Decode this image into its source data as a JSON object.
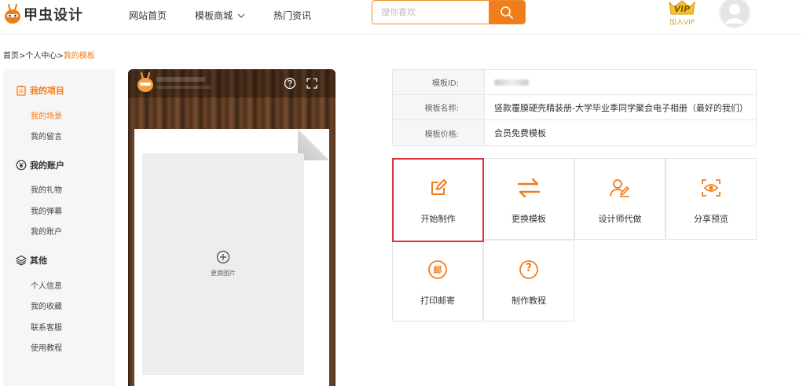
{
  "header": {
    "logo_text": "甲虫设计",
    "nav": [
      "网站首页",
      "模板商城",
      "热门资讯"
    ],
    "search_placeholder": "搜你喜欢",
    "vip_label": "加入VIP",
    "vip_badge": "VIP"
  },
  "breadcrumb": {
    "home": "首页",
    "sep1": ">",
    "center": "个人中心",
    "sep2": ">",
    "current": "我的模板"
  },
  "sidebar": {
    "sections": [
      {
        "title": "我的项目",
        "items": [
          "我的场景",
          "我的留言"
        ]
      },
      {
        "title": "我的账户",
        "items": [
          "我的礼物",
          "我的弹幕",
          "我的账户"
        ]
      },
      {
        "title": "其他",
        "items": [
          "个人信息",
          "我的收藏",
          "联系客服",
          "使用教程"
        ]
      }
    ]
  },
  "preview": {
    "change_image": "更换图片"
  },
  "info": {
    "id_label": "模板ID:",
    "name_label": "模板名称:",
    "name_value": "竖款覆膜硬壳精装册-大学毕业季同学聚会电子相册（最好的我们）",
    "price_label": "模板价格:",
    "price_value": "会员免费模板"
  },
  "actions": [
    {
      "label": "开始制作",
      "icon": "edit-icon"
    },
    {
      "label": "更换模板",
      "icon": "swap-icon"
    },
    {
      "label": "设计师代做",
      "icon": "designer-icon"
    },
    {
      "label": "分享预览",
      "icon": "share-preview-icon"
    },
    {
      "label": "打印邮寄",
      "icon": "mail-icon",
      "glyph": "邮"
    },
    {
      "label": "制作教程",
      "icon": "help-icon",
      "glyph": "?"
    }
  ],
  "colors": {
    "accent": "#f07d1c",
    "selected_border": "#d9363e",
    "sidebar_bg": "#f6f6f6"
  }
}
